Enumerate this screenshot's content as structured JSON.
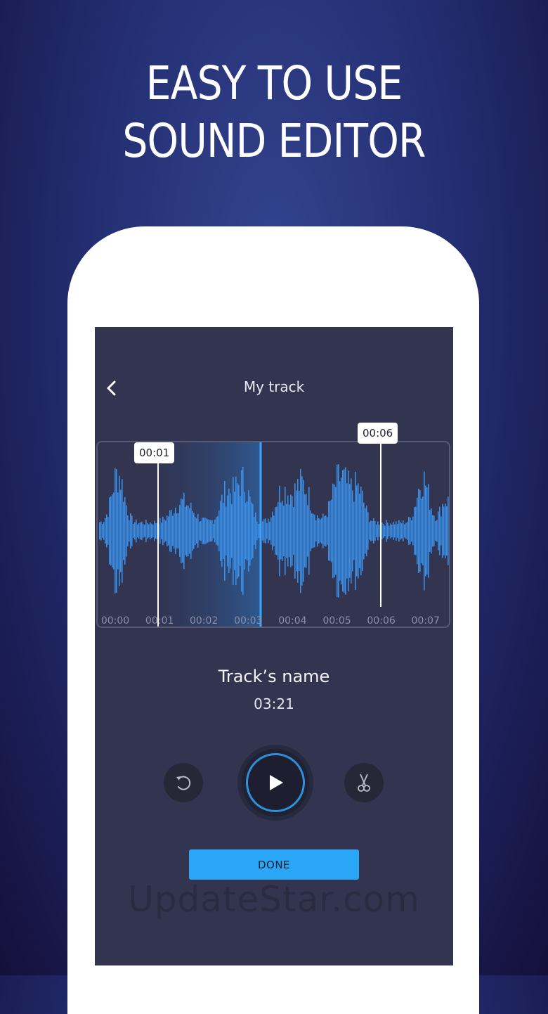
{
  "promo": {
    "line1": "EASY TO USE",
    "line2": "SOUND EDITOR"
  },
  "screen": {
    "title": "My track",
    "back_icon": "chevron-left-icon",
    "markers": {
      "start": "00:01",
      "end": "00:06"
    },
    "timeline_ticks": [
      "00:00",
      "00:01",
      "00:02",
      "00:03",
      "00:04",
      "00:05",
      "00:06",
      "00:07"
    ],
    "track_name": "Track’s name",
    "track_duration": "03:21",
    "controls": {
      "undo_icon": "undo-icon",
      "play_icon": "play-icon",
      "cut_icon": "scissors-icon"
    },
    "done_label": "DONE"
  },
  "watermark": "UpdateStar.com",
  "colors": {
    "accent": "#2aa6f6",
    "waveform": "#3a8ee6",
    "screen_bg": "#333450"
  }
}
